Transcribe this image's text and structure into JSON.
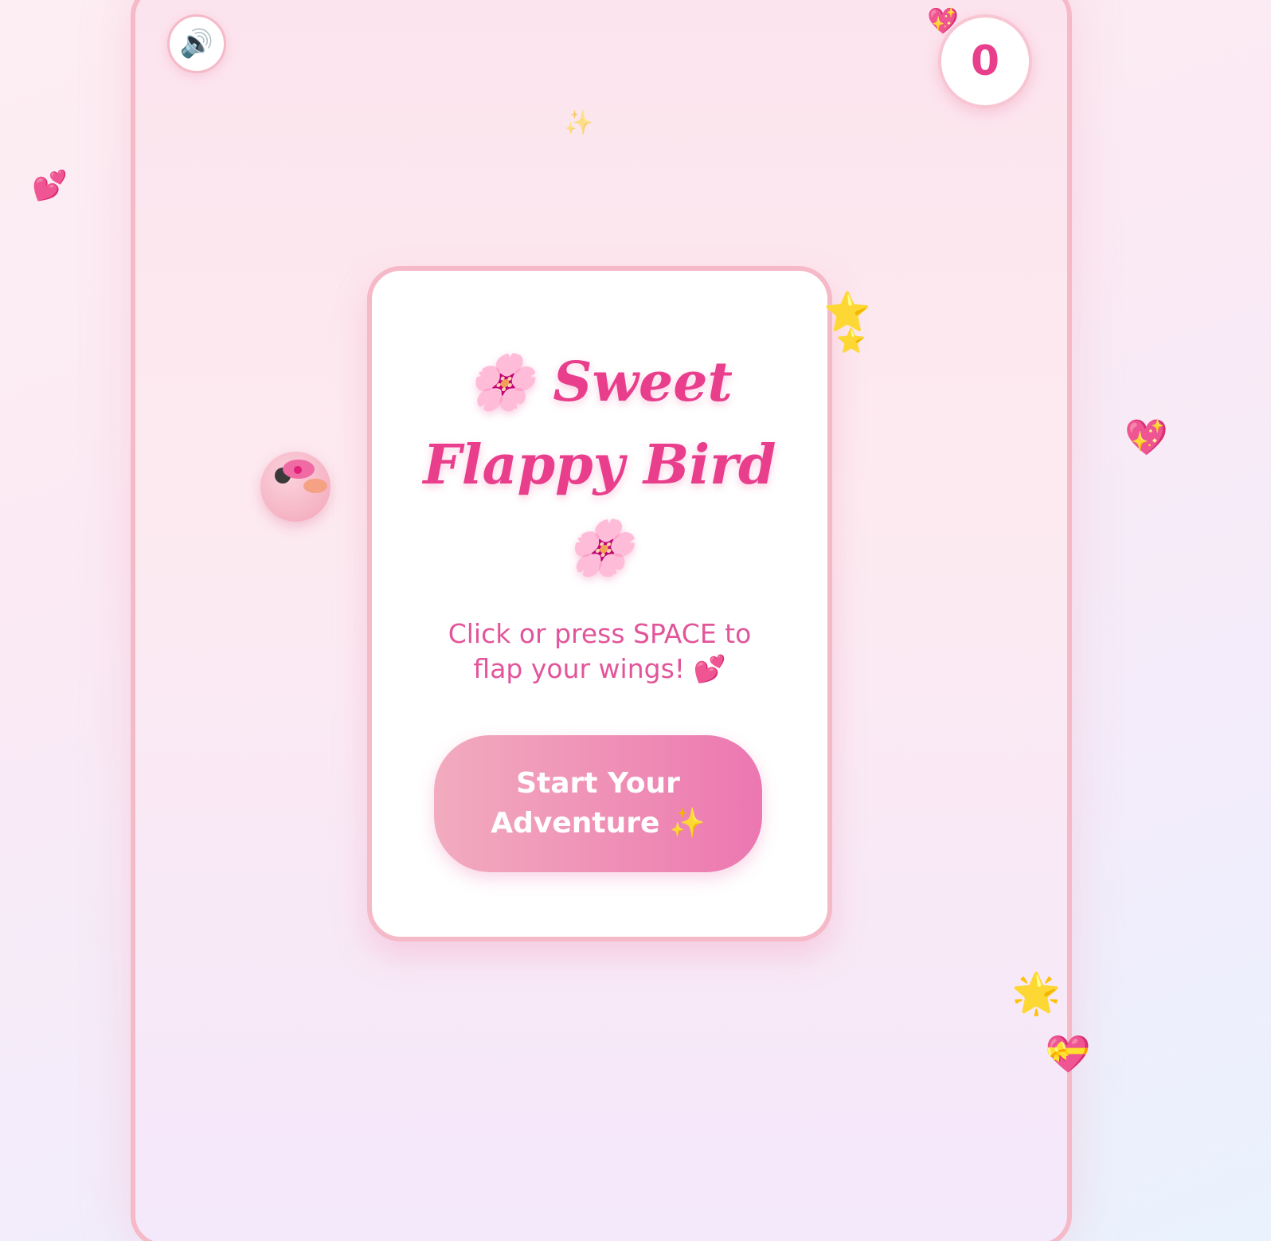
{
  "game": {
    "title": "🌸 Sweet Flappy Bird 🌸",
    "instructions": "Click or press SPACE to flap your wings! 💕",
    "start_button_label": "Start Your Adventure ✨",
    "score": "0",
    "sound_icon": "🔊"
  },
  "decorations": {
    "hearts_left": "💕",
    "sparkle_heart_top": "💖",
    "sparkles_top": "✨",
    "stars_card": "⭐",
    "star_small": "⭐",
    "sparkle_heart_right": "💖",
    "glowing_star": "🌟",
    "gift_heart": "💝",
    "faint_sparkle": "✨"
  },
  "colors": {
    "accent": "#e83e8c",
    "border": "#f5b9c8",
    "button_start": "#f2abbf",
    "button_end": "#ec77b1"
  },
  "icons": {
    "sound": "speaker-icon",
    "bird": "bird-icon"
  }
}
